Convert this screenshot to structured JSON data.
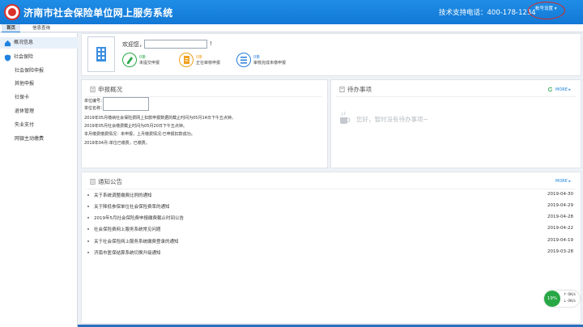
{
  "header": {
    "title": "济南市社会保险单位网上服务系统",
    "support": "技术支持电话：400-178-1234",
    "account_label": "帐号设置 ▾"
  },
  "tabs": [
    {
      "label": "首页",
      "active": true
    },
    {
      "label": "信息查询",
      "active": false
    }
  ],
  "sidebar": {
    "items": [
      {
        "label": "概况信息",
        "icon": "home-icon",
        "active": true
      },
      {
        "label": "社会保险",
        "icon": "shield-icon"
      },
      {
        "label": "社会保险申报"
      },
      {
        "label": "其他申报"
      },
      {
        "label": "社保卡"
      },
      {
        "label": "退休管理"
      },
      {
        "label": "失业支付"
      },
      {
        "label": "网银主动缴费"
      }
    ]
  },
  "welcome": {
    "greeting": "欢迎您，",
    "name_value": "",
    "exclaim": "!",
    "stats": [
      {
        "count": "0条",
        "label": "未提交申报",
        "color": "#2aa84a",
        "icon": "pen-icon"
      },
      {
        "count": "0条",
        "label": "正在审核申报",
        "color": "#f0a020",
        "icon": "document-icon"
      },
      {
        "count": "0条",
        "label": "审核完成未缴申报",
        "color": "#2b7fd6",
        "icon": "list-icon"
      }
    ]
  },
  "declare": {
    "title": "申报概况",
    "unit_code_label": "单位编号：",
    "unit_name_label": "单位名称：",
    "unit_code_value": "",
    "unit_name_value": "",
    "lines": [
      "2019年05月缴纳社会保险费网上扣款申报数据的截止时间为05月14日下午五点钟。",
      "2019年05月社会缴费截止时间为05月20日下午五点钟。",
      "本月缴费缴费情况：未申报，上月缴费情况:已申报扣款成功。",
      "2019年04月:单位已缴费，已缴费。"
    ]
  },
  "todo": {
    "title": "待办事项",
    "more": "MORE ▸",
    "empty": "您好，暂时没有待办事项~"
  },
  "notices": {
    "title": "通知公告",
    "more": "MORE ▸",
    "items": [
      {
        "title": "关于系统调整缴费比例的通知",
        "date": "2019-04-30"
      },
      {
        "title": "关于降低参保单位社会保险费率的通知",
        "date": "2019-04-29"
      },
      {
        "title": "2019年5月社会保险费申报缴费截止时间公告",
        "date": "2019-04-28"
      },
      {
        "title": "社会保险费网上服务系统常见问题",
        "date": "2019-04-22"
      },
      {
        "title": "关于社会保险网上服务系统缴费登录的通知",
        "date": "2019-04-19"
      },
      {
        "title": "济南市医保结算系统切换升级通知",
        "date": "2019-03-28"
      }
    ]
  },
  "widget": {
    "percent": "19%",
    "up": "↑ 0K/s",
    "down": "↓ 0K/s"
  },
  "colors": {
    "header": "#1a84e0",
    "accent": "#1f82de",
    "logo_red": "#d9322b"
  }
}
